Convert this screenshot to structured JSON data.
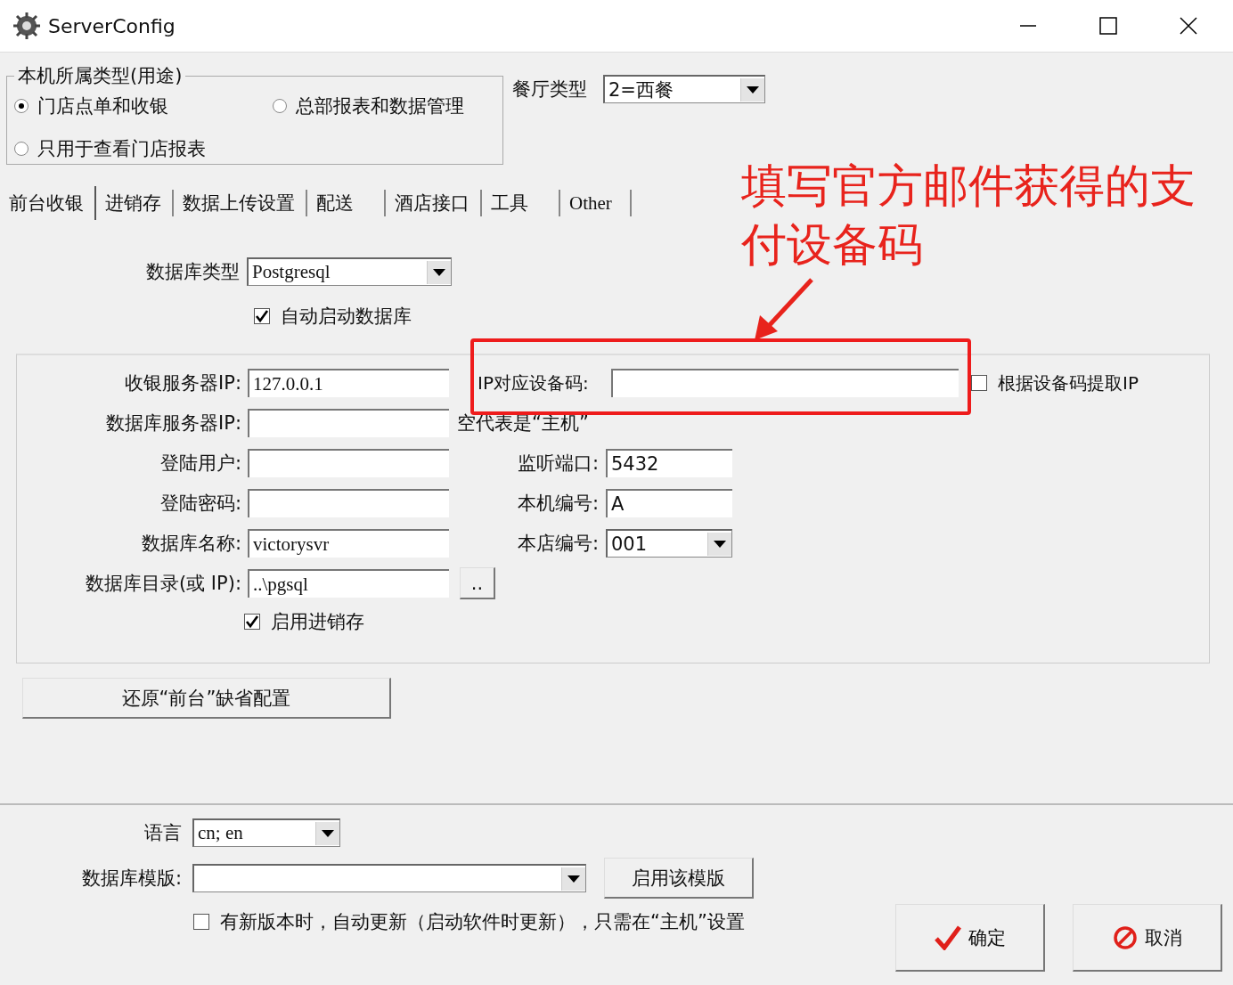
{
  "window": {
    "title": "ServerConfig"
  },
  "usage_group": {
    "legend": "本机所属类型(用途)",
    "options": [
      {
        "label": "门店点单和收银",
        "selected": true
      },
      {
        "label": "总部报表和数据管理",
        "selected": false
      },
      {
        "label": "只用于查看门店报表",
        "selected": false
      }
    ]
  },
  "restaurant_type": {
    "label": "餐厅类型",
    "value": "2=西餐"
  },
  "tabs": [
    {
      "label": "前台收银",
      "selected": true
    },
    {
      "label": "进销存",
      "selected": false
    },
    {
      "label": "数据上传设置",
      "selected": false
    },
    {
      "label": "配送",
      "selected": false
    },
    {
      "label": "酒店接口",
      "selected": false
    },
    {
      "label": "工具",
      "selected": false
    },
    {
      "label": "Other",
      "selected": false
    }
  ],
  "db_type": {
    "label": "数据库类型",
    "value": "Postgresql"
  },
  "auto_start_db": {
    "label": "自动启动数据库",
    "checked": true
  },
  "server_fields": [
    {
      "kind": "text",
      "label": "收银服务器IP:",
      "value": "127.0.0.1"
    },
    {
      "kind": "text",
      "label": "数据库服务器IP:"
    },
    {
      "kind": "text",
      "label": "登陆用户:"
    },
    {
      "kind": "text",
      "label": "登陆密码:"
    },
    {
      "kind": "text",
      "label": "数据库名称:",
      "value": "victorysvr"
    },
    {
      "kind": "browse",
      "label": "数据库目录(或 IP):",
      "value": "..\\pgsql",
      "button": ".."
    }
  ],
  "device_code": {
    "label": "IP对应设备码:"
  },
  "extract_ip": {
    "label": "根据设备码提取IP",
    "checked": false
  },
  "db_server_note": "空代表是“主机”",
  "right_fields": [
    {
      "kind": "text",
      "label": "监听端口:",
      "value": "5432"
    },
    {
      "kind": "text",
      "label": "本机编号:",
      "value": "A"
    },
    {
      "kind": "combo",
      "label": "本店编号:",
      "value": "001"
    }
  ],
  "enable_inventory": {
    "label": "启用进销存",
    "checked": true
  },
  "restore_button": "还原“前台”缺省配置",
  "language": {
    "label": "语言",
    "value": "cn; en"
  },
  "db_template": {
    "label": "数据库模版:",
    "button": "启用该模版"
  },
  "auto_update": {
    "label": "有新版本时，自动更新（启动软件时更新），只需在“主机”设置",
    "checked": false
  },
  "ok_button": "确定",
  "cancel_button": "取消",
  "annotation": {
    "text": "填写官方邮件获得的支付设备码"
  }
}
